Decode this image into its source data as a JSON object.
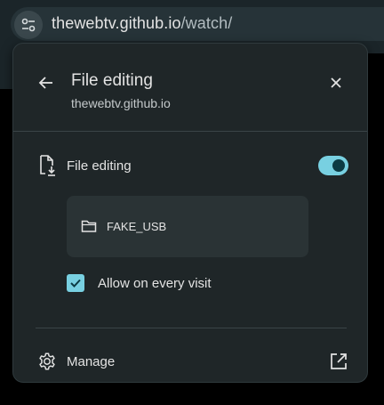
{
  "address_bar": {
    "domain": "thewebtv.github.io",
    "path": "/watch/"
  },
  "popup": {
    "title": "File editing",
    "subtitle": "thewebtv.github.io",
    "permission": {
      "label": "File editing",
      "enabled": true
    },
    "device": {
      "label": "FAKE_USB"
    },
    "allow_every_visit": {
      "label": "Allow on every visit",
      "checked": true
    },
    "manage": {
      "label": "Manage"
    }
  },
  "colors": {
    "accent": "#78d0e1",
    "popup_bg": "#1f2628",
    "text": "#e3e3e3"
  }
}
